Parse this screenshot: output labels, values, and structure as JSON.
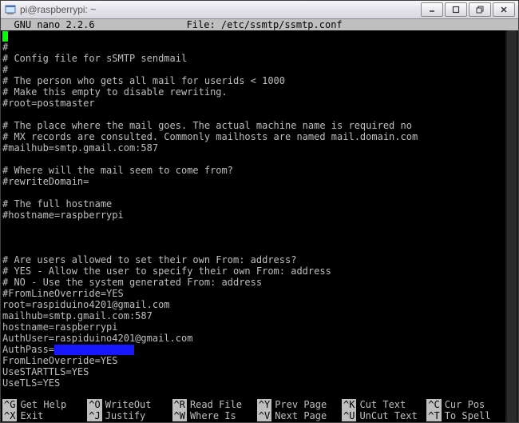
{
  "window": {
    "title": "pi@raspberrypi: ~"
  },
  "nano": {
    "header": {
      "left": "  GNU nano 2.2.6",
      "center": "       File: /etc/ssmtp/ssmtp.conf"
    },
    "lines": {
      "l01": "#",
      "l02": "# Config file for sSMTP sendmail",
      "l03": "#",
      "l04": "# The person who gets all mail for userids < 1000",
      "l05": "# Make this empty to disable rewriting.",
      "l06": "#root=postmaster",
      "l07": "",
      "l08": "# The place where the mail goes. The actual machine name is required no",
      "l09": "# MX records are consulted. Commonly mailhosts are named mail.domain.com",
      "l10": "#mailhub=smtp.gmail.com:587",
      "l11": "",
      "l12": "# Where will the mail seem to come from?",
      "l13": "#rewriteDomain=",
      "l14": "",
      "l15": "# The full hostname",
      "l16": "#hostname=raspberrypi",
      "l17": "",
      "l18": "",
      "l19": "",
      "l20": "# Are users allowed to set their own From: address?",
      "l21": "# YES - Allow the user to specify their own From: address",
      "l22": "# NO - Use the system generated From: address",
      "l23": "#FromLineOverride=YES",
      "l24": "root=raspiduino4201@gmail.com",
      "l25": "mailhub=smtp.gmail.com:587",
      "l26": "hostname=raspberrypi",
      "l27": "AuthUser=raspiduino4201@gmail.com",
      "l28": "AuthPass=",
      "l29": "FromLineOverride=YES",
      "l30": "UseSTARTTLS=YES",
      "l31": "UseTLS=YES"
    },
    "footer": {
      "r1": {
        "k1": "^G",
        "a1": "Get Help",
        "k2": "^O",
        "a2": "WriteOut",
        "k3": "^R",
        "a3": "Read File",
        "k4": "^Y",
        "a4": "Prev Page",
        "k5": "^K",
        "a5": "Cut Text",
        "k6": "^C",
        "a6": "Cur Pos"
      },
      "r2": {
        "k1": "^X",
        "a1": "Exit",
        "k2": "^J",
        "a2": "Justify",
        "k3": "^W",
        "a3": "Where Is",
        "k4": "^V",
        "a4": "Next Page",
        "k5": "^U",
        "a5": "UnCut Text",
        "k6": "^T",
        "a6": "To Spell"
      }
    }
  }
}
